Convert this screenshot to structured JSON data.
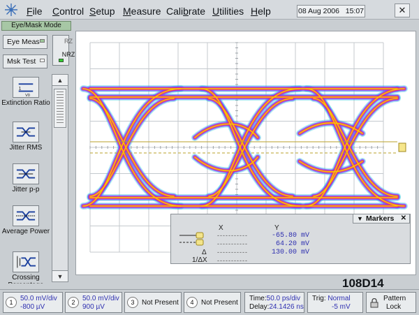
{
  "menu": {
    "items": [
      "File",
      "Control",
      "Setup",
      "Measure",
      "Calibrate",
      "Utilities",
      "Help"
    ],
    "underline": [
      "F",
      "C",
      "S",
      "M",
      "b",
      "U",
      "H"
    ]
  },
  "datetime": {
    "date": "08 Aug 2006",
    "time": "15:07"
  },
  "close_icon": "close-icon",
  "mode": "Eye/Mask Mode",
  "left": {
    "eye_meas": "Eye Meas",
    "msk_test": "Msk Test",
    "rz": "RZ",
    "nrz": "NRZ",
    "measurements": [
      {
        "label": "Extinction Ratio",
        "icon": "extinction-ratio-icon"
      },
      {
        "label": "Jitter RMS",
        "icon": "jitter-rms-icon"
      },
      {
        "label": "Jitter p-p",
        "icon": "jitter-pp-icon"
      },
      {
        "label": "Average Power",
        "icon": "average-power-icon"
      },
      {
        "label": "Crossing Percentage",
        "icon": "crossing-percentage-icon"
      }
    ]
  },
  "markers": {
    "title": "Markers",
    "col_x": "X",
    "col_y": "Y",
    "delta": "Δ",
    "inv_delta": "1/ΔX",
    "y1": "-65.80 mV",
    "y2": "64.20 mV",
    "dy": "130.00 mV",
    "dash": "-----------"
  },
  "label_code": "108D14",
  "bottom": {
    "ch1": {
      "num": "1",
      "scale": "50.0 mV/div",
      "offset": "-800 µV"
    },
    "ch2": {
      "num": "2",
      "scale": "50.0 mV/div",
      "offset": "900 µV"
    },
    "ch3": {
      "num": "3",
      "status": "Not Present"
    },
    "ch4": {
      "num": "4",
      "status": "Not Present"
    },
    "time": {
      "line1_label": "Time:",
      "line1_value": "50.0 ps/div",
      "line2_label": "Delay:",
      "line2_value": "24.1426 ns"
    },
    "trig": {
      "label": "Trig:",
      "mode": "Normal",
      "level": "-5 mV"
    },
    "pattern": {
      "line1": "Pattern",
      "line2": "Lock"
    }
  },
  "colors": {
    "eye_core": "#f8c500",
    "eye_mid": "#ee2f6a",
    "eye_outer": "#7b3cff",
    "eye_edge": "#1bc7d6",
    "grid": "#c4c9ce"
  }
}
